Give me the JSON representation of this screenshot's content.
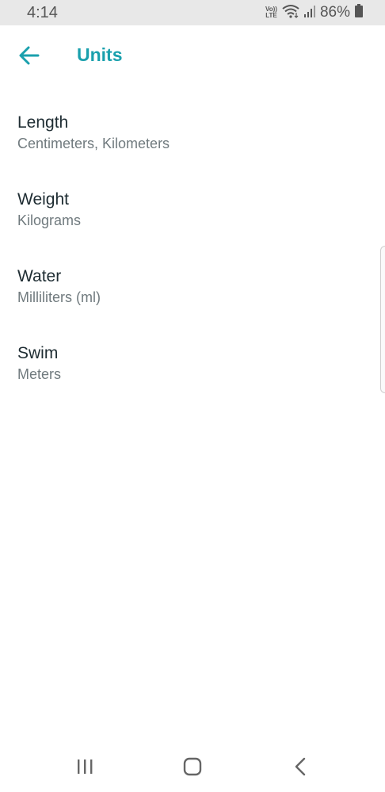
{
  "status_bar": {
    "time": "4:14",
    "volte_top": "Vo))",
    "volte_bottom": "LTE",
    "battery": "86%"
  },
  "header": {
    "title": "Units",
    "accent_color": "#1aa0ad"
  },
  "units": [
    {
      "label": "Length",
      "value": "Centimeters, Kilometers"
    },
    {
      "label": "Weight",
      "value": "Kilograms"
    },
    {
      "label": "Water",
      "value": "Milliliters (ml)"
    },
    {
      "label": "Swim",
      "value": "Meters"
    }
  ],
  "nav": {
    "icons": [
      "recent-apps-icon",
      "home-icon",
      "back-nav-icon"
    ]
  }
}
